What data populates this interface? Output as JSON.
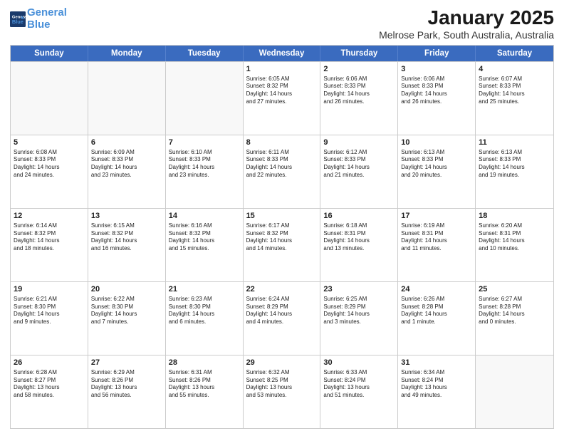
{
  "header": {
    "logo_line1": "General",
    "logo_line2": "Blue",
    "title": "January 2025",
    "subtitle": "Melrose Park, South Australia, Australia"
  },
  "days_of_week": [
    "Sunday",
    "Monday",
    "Tuesday",
    "Wednesday",
    "Thursday",
    "Friday",
    "Saturday"
  ],
  "rows": [
    [
      {
        "day": "",
        "info": ""
      },
      {
        "day": "",
        "info": ""
      },
      {
        "day": "",
        "info": ""
      },
      {
        "day": "1",
        "info": "Sunrise: 6:05 AM\nSunset: 8:32 PM\nDaylight: 14 hours\nand 27 minutes."
      },
      {
        "day": "2",
        "info": "Sunrise: 6:06 AM\nSunset: 8:33 PM\nDaylight: 14 hours\nand 26 minutes."
      },
      {
        "day": "3",
        "info": "Sunrise: 6:06 AM\nSunset: 8:33 PM\nDaylight: 14 hours\nand 26 minutes."
      },
      {
        "day": "4",
        "info": "Sunrise: 6:07 AM\nSunset: 8:33 PM\nDaylight: 14 hours\nand 25 minutes."
      }
    ],
    [
      {
        "day": "5",
        "info": "Sunrise: 6:08 AM\nSunset: 8:33 PM\nDaylight: 14 hours\nand 24 minutes."
      },
      {
        "day": "6",
        "info": "Sunrise: 6:09 AM\nSunset: 8:33 PM\nDaylight: 14 hours\nand 23 minutes."
      },
      {
        "day": "7",
        "info": "Sunrise: 6:10 AM\nSunset: 8:33 PM\nDaylight: 14 hours\nand 23 minutes."
      },
      {
        "day": "8",
        "info": "Sunrise: 6:11 AM\nSunset: 8:33 PM\nDaylight: 14 hours\nand 22 minutes."
      },
      {
        "day": "9",
        "info": "Sunrise: 6:12 AM\nSunset: 8:33 PM\nDaylight: 14 hours\nand 21 minutes."
      },
      {
        "day": "10",
        "info": "Sunrise: 6:13 AM\nSunset: 8:33 PM\nDaylight: 14 hours\nand 20 minutes."
      },
      {
        "day": "11",
        "info": "Sunrise: 6:13 AM\nSunset: 8:33 PM\nDaylight: 14 hours\nand 19 minutes."
      }
    ],
    [
      {
        "day": "12",
        "info": "Sunrise: 6:14 AM\nSunset: 8:32 PM\nDaylight: 14 hours\nand 18 minutes."
      },
      {
        "day": "13",
        "info": "Sunrise: 6:15 AM\nSunset: 8:32 PM\nDaylight: 14 hours\nand 16 minutes."
      },
      {
        "day": "14",
        "info": "Sunrise: 6:16 AM\nSunset: 8:32 PM\nDaylight: 14 hours\nand 15 minutes."
      },
      {
        "day": "15",
        "info": "Sunrise: 6:17 AM\nSunset: 8:32 PM\nDaylight: 14 hours\nand 14 minutes."
      },
      {
        "day": "16",
        "info": "Sunrise: 6:18 AM\nSunset: 8:31 PM\nDaylight: 14 hours\nand 13 minutes."
      },
      {
        "day": "17",
        "info": "Sunrise: 6:19 AM\nSunset: 8:31 PM\nDaylight: 14 hours\nand 11 minutes."
      },
      {
        "day": "18",
        "info": "Sunrise: 6:20 AM\nSunset: 8:31 PM\nDaylight: 14 hours\nand 10 minutes."
      }
    ],
    [
      {
        "day": "19",
        "info": "Sunrise: 6:21 AM\nSunset: 8:30 PM\nDaylight: 14 hours\nand 9 minutes."
      },
      {
        "day": "20",
        "info": "Sunrise: 6:22 AM\nSunset: 8:30 PM\nDaylight: 14 hours\nand 7 minutes."
      },
      {
        "day": "21",
        "info": "Sunrise: 6:23 AM\nSunset: 8:30 PM\nDaylight: 14 hours\nand 6 minutes."
      },
      {
        "day": "22",
        "info": "Sunrise: 6:24 AM\nSunset: 8:29 PM\nDaylight: 14 hours\nand 4 minutes."
      },
      {
        "day": "23",
        "info": "Sunrise: 6:25 AM\nSunset: 8:29 PM\nDaylight: 14 hours\nand 3 minutes."
      },
      {
        "day": "24",
        "info": "Sunrise: 6:26 AM\nSunset: 8:28 PM\nDaylight: 14 hours\nand 1 minute."
      },
      {
        "day": "25",
        "info": "Sunrise: 6:27 AM\nSunset: 8:28 PM\nDaylight: 14 hours\nand 0 minutes."
      }
    ],
    [
      {
        "day": "26",
        "info": "Sunrise: 6:28 AM\nSunset: 8:27 PM\nDaylight: 13 hours\nand 58 minutes."
      },
      {
        "day": "27",
        "info": "Sunrise: 6:29 AM\nSunset: 8:26 PM\nDaylight: 13 hours\nand 56 minutes."
      },
      {
        "day": "28",
        "info": "Sunrise: 6:31 AM\nSunset: 8:26 PM\nDaylight: 13 hours\nand 55 minutes."
      },
      {
        "day": "29",
        "info": "Sunrise: 6:32 AM\nSunset: 8:25 PM\nDaylight: 13 hours\nand 53 minutes."
      },
      {
        "day": "30",
        "info": "Sunrise: 6:33 AM\nSunset: 8:24 PM\nDaylight: 13 hours\nand 51 minutes."
      },
      {
        "day": "31",
        "info": "Sunrise: 6:34 AM\nSunset: 8:24 PM\nDaylight: 13 hours\nand 49 minutes."
      },
      {
        "day": "",
        "info": ""
      }
    ]
  ]
}
